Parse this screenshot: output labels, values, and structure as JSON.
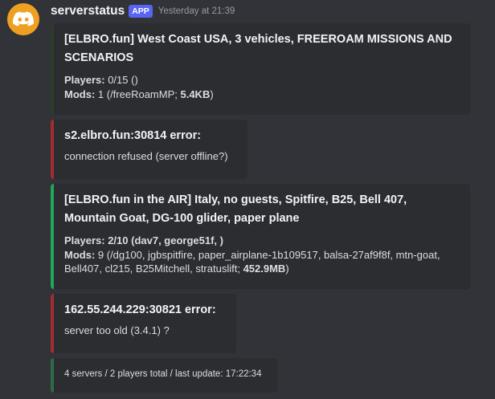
{
  "message": {
    "username": "serverstatus",
    "badge": "APP",
    "timestamp": "Yesterday at 21:39",
    "avatar_icon": "discord-logo-icon",
    "avatar_color": "#f0a020"
  },
  "embeds": [
    {
      "title": "[ELBRO.fun]  West Coast USA,  3 vehicles, FREEROAM MISSIONS AND SCENARIOS",
      "players_label": "Players:",
      "players_value": " 0/15 ()",
      "mods_label": "Mods:",
      "mods_value": " 1 (/freeRoamMP; ",
      "mods_size": "5.4KB",
      "mods_close": ")"
    },
    {
      "title": "s2.elbro.fun:30814 error:",
      "description": "connection refused (server offline?)"
    },
    {
      "title": "[ELBRO.fun in the AIR]  Italy, no guests, Spitfire, B25, Bell 407, Mountain Goat, DG-100 glider, paper plane",
      "players_label": "Players:",
      "players_value": " 2/10 (dav7, george51f, )",
      "mods_label": "Mods:",
      "mods_value": " 9 (/dg100, jgbspitfire, paper_airplane-1b109517, balsa-27af9f8f, mtn-goat, Bell407, cl215, B25Mitchell, stratuslift; ",
      "mods_size": "452.9MB",
      "mods_close": ")"
    },
    {
      "title": "162.55.244.229:30821 error:",
      "description": "server too old (3.4.1) ?"
    },
    {
      "footer": "4 servers / 2 players total / last update: 17:22:34"
    }
  ],
  "colors": {
    "background": "#313338",
    "embed_background": "#2b2d31",
    "error_accent": "#a12d2f",
    "online_accent": "#23a55a",
    "app_badge": "#5865f2"
  }
}
